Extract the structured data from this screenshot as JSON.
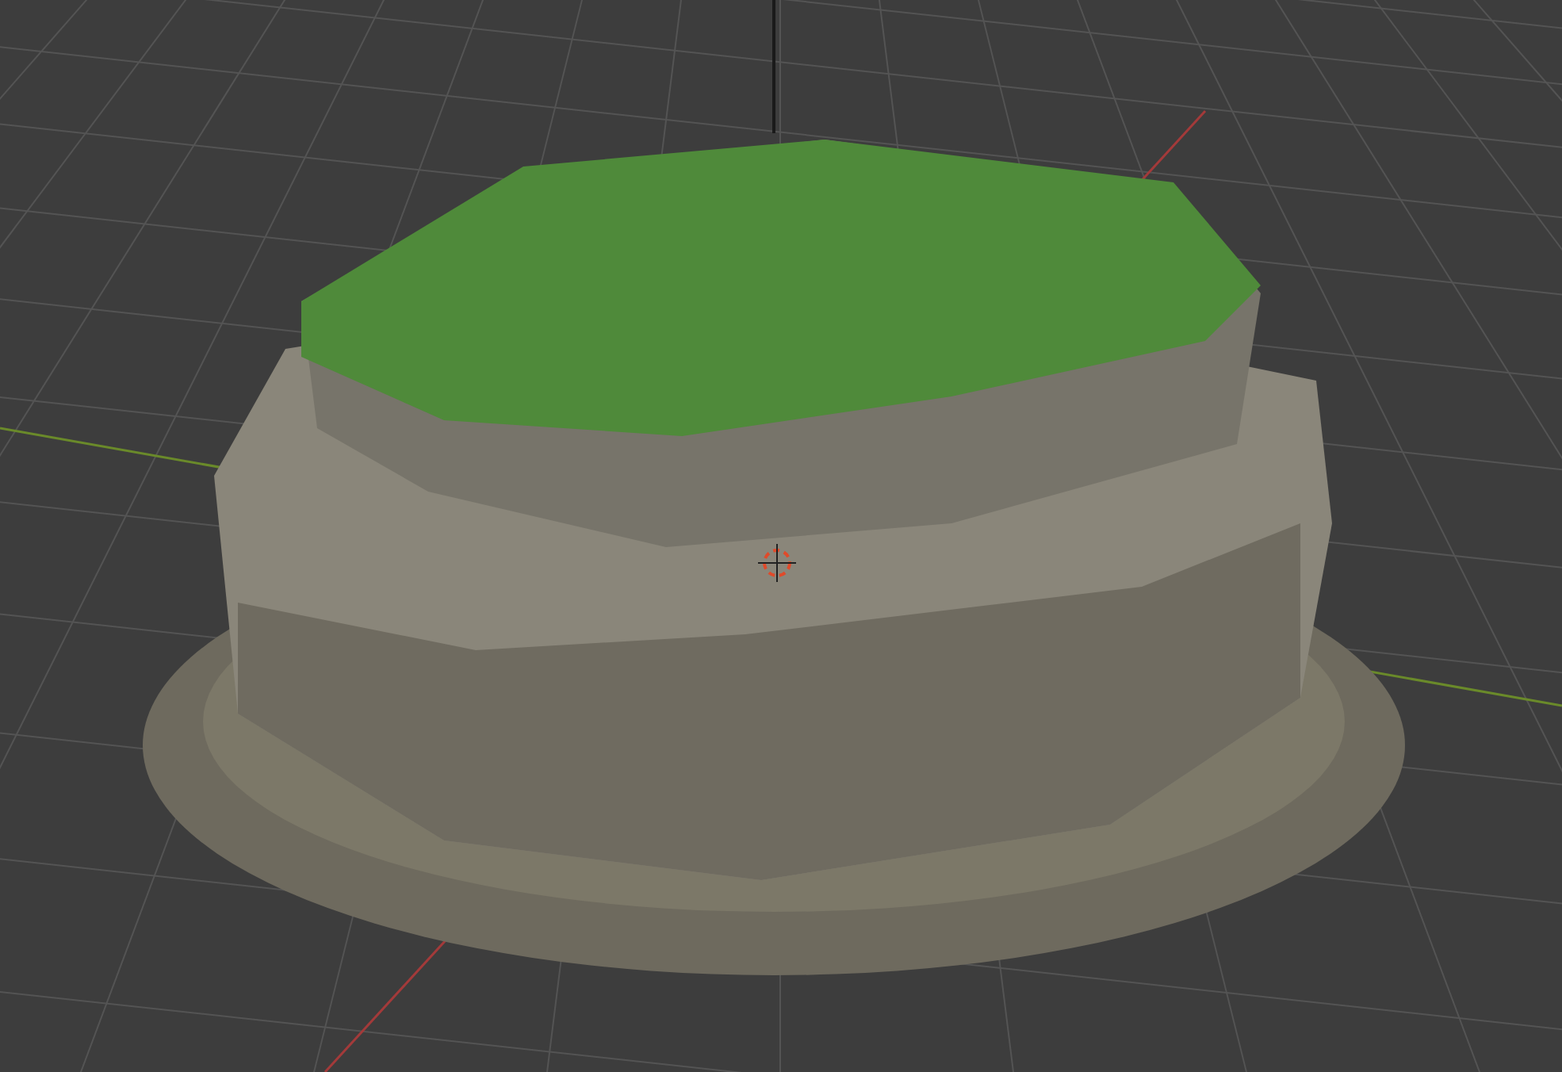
{
  "viewport": {
    "grid_visible": true,
    "x_axis_visible": true,
    "y_axis_visible": true,
    "z_axis_visible": true,
    "cursor_visible": true
  }
}
